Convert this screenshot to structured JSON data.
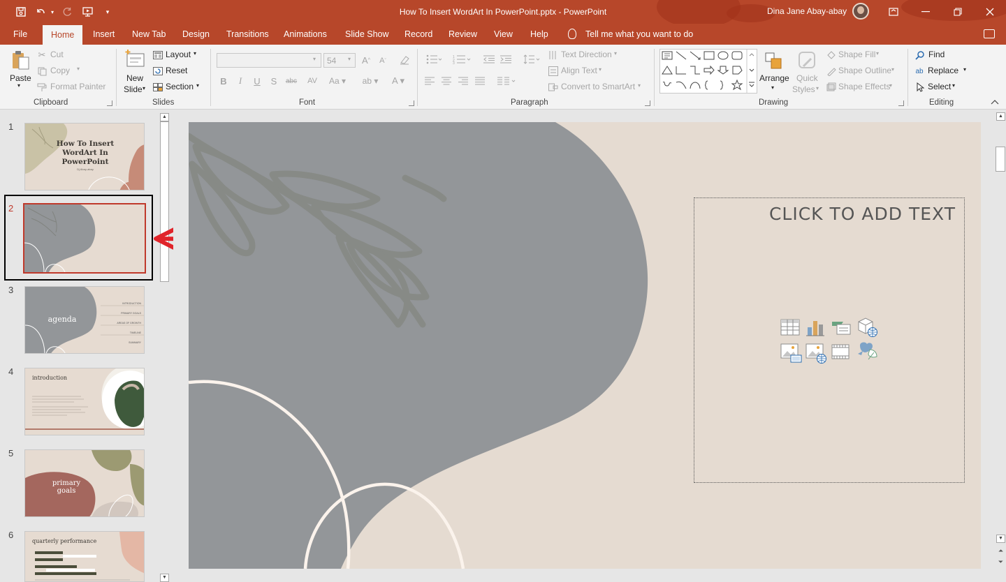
{
  "window": {
    "title": "How To Insert WordArt In PowerPoint.pptx  -  PowerPoint",
    "user": "Dina Jane Abay-abay"
  },
  "menu": {
    "tabs": [
      "File",
      "Home",
      "Insert",
      "New Tab",
      "Design",
      "Transitions",
      "Animations",
      "Slide Show",
      "Record",
      "Review",
      "View",
      "Help"
    ],
    "tell_me": "Tell me what you want to do"
  },
  "ribbon": {
    "clipboard": {
      "label": "Clipboard",
      "paste": "Paste",
      "cut": "Cut",
      "copy": "Copy",
      "format_painter": "Format Painter"
    },
    "slides": {
      "label": "Slides",
      "new_slide_1": "New",
      "new_slide_2": "Slide",
      "layout": "Layout",
      "reset": "Reset",
      "section": "Section"
    },
    "font": {
      "label": "Font",
      "font_name": "",
      "font_size": "54"
    },
    "paragraph": {
      "label": "Paragraph",
      "text_direction": "Text Direction",
      "align_text": "Align Text",
      "convert_smartart": "Convert to SmartArt"
    },
    "drawing": {
      "label": "Drawing",
      "arrange": "Arrange",
      "quick_styles_1": "Quick",
      "quick_styles_2": "Styles",
      "shape_fill": "Shape Fill",
      "shape_outline": "Shape Outline",
      "shape_effects": "Shape Effects"
    },
    "editing": {
      "label": "Editing",
      "find": "Find",
      "replace": "Replace",
      "select": "Select"
    }
  },
  "thumbnails": [
    {
      "num": "1",
      "title_lines": [
        "How To Insert",
        "WordArt In",
        "PowerPoint"
      ],
      "subtitle": "Dj Abay-abay"
    },
    {
      "num": "2",
      "selected": true
    },
    {
      "num": "3",
      "title": "agenda",
      "items": [
        "INTRODUCTION",
        "PRIMARY GOALS",
        "AREAS OF GROWTH",
        "TIMELINE",
        "SUMMARY"
      ]
    },
    {
      "num": "4",
      "title": "introduction"
    },
    {
      "num": "5",
      "title_lines": [
        "primary",
        "goals"
      ]
    },
    {
      "num": "6",
      "title": "quarterly performance"
    }
  ],
  "slide": {
    "placeholder_text": "CLICK TO ADD TEXT"
  },
  "colors": {
    "accent": "#b7472a",
    "slide_bg": "#e5dbd1",
    "slide_gray": "#939699",
    "annotation_arrow": "#e0242a"
  }
}
